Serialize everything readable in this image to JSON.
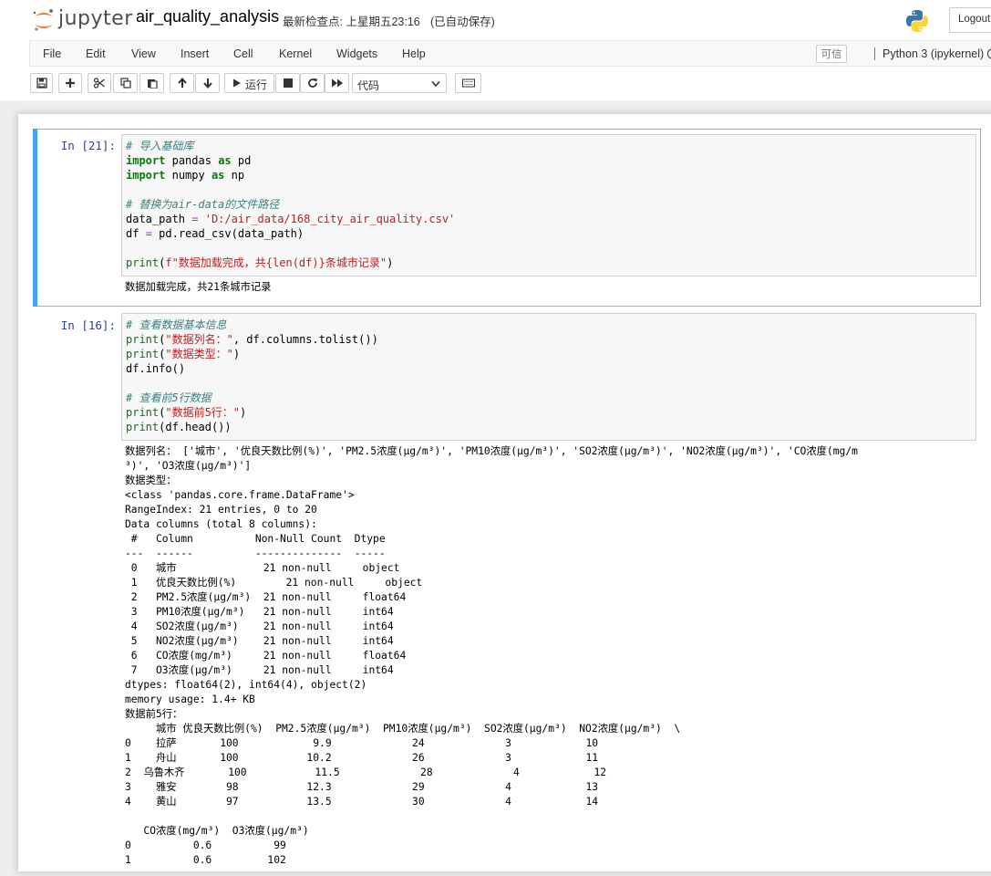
{
  "header": {
    "logo_text": "jupyter",
    "notebook_name": "air_quality_analysis",
    "checkpoint": "最新检查点: 上星期五23:16",
    "autosave": "(已自动保存)",
    "logout": "Logout"
  },
  "menu": {
    "items": [
      "File",
      "Edit",
      "View",
      "Insert",
      "Cell",
      "Kernel",
      "Widgets",
      "Help"
    ],
    "trusted": "可信",
    "kernel": "Python 3 (ipykernel)"
  },
  "toolbar": {
    "run_label": "运行",
    "cell_type": "代码"
  },
  "cells": [
    {
      "prompt": "In  [21]:",
      "code": [
        "# 导入基础库",
        "import pandas as pd",
        "import numpy as np",
        "",
        "# 替换为air-data的文件路径",
        "data_path = 'D:/air_data/168_city_air_quality.csv'",
        "df = pd.read_csv(data_path)",
        "",
        "print(f\"数据加载完成，共{len(df)}条城市记录\")"
      ],
      "output": [
        "数据加载完成，共21条城市记录"
      ]
    },
    {
      "prompt": "In  [16]:",
      "code": [
        "# 查看数据基本信息",
        "print(\"数据列名：\", df.columns.tolist())",
        "print(\"数据类型：\")",
        "df.info()",
        "",
        "# 查看前5行数据",
        "print(\"数据前5行：\")",
        "print(df.head())"
      ],
      "output": [
        "数据列名： ['城市', '优良天数比例(%)', 'PM2.5浓度(μg/m³)', 'PM10浓度(μg/m³)', 'SO2浓度(μg/m³)', 'NO2浓度(μg/m³)', 'CO浓度(mg/m",
        "³)', 'O3浓度(μg/m³)']",
        "数据类型：",
        "<class 'pandas.core.frame.DataFrame'>",
        "RangeIndex: 21 entries, 0 to 20",
        "Data columns (total 8 columns):",
        " #   Column          Non-Null Count  Dtype",
        "---  ------          --------------  -----",
        " 0   城市              21 non-null     object",
        " 1   优良天数比例(%)        21 non-null     object",
        " 2   PM2.5浓度(μg/m³)  21 non-null     float64",
        " 3   PM10浓度(μg/m³)   21 non-null     int64",
        " 4   SO2浓度(μg/m³)    21 non-null     int64",
        " 5   NO2浓度(μg/m³)    21 non-null     int64",
        " 6   CO浓度(mg/m³)     21 non-null     float64",
        " 7   O3浓度(μg/m³)     21 non-null     int64",
        "dtypes: float64(2), int64(4), object(2)",
        "memory usage: 1.4+ KB",
        "数据前5行：",
        "     城市 优良天数比例(%)  PM2.5浓度(μg/m³)  PM10浓度(μg/m³)  SO2浓度(μg/m³)  NO2浓度(μg/m³)  \\",
        "0    拉萨       100            9.9             24             3            10",
        "1    舟山       100           10.2             26             3            11",
        "2  乌鲁木齐       100           11.5             28             4            12",
        "3    雅安        98           12.3             29             4            13",
        "4    黄山        97           13.5             30             4            14",
        "",
        "   CO浓度(mg/m³)  O3浓度(μg/m³)",
        "0          0.6          99",
        "1          0.6         102"
      ]
    }
  ]
}
